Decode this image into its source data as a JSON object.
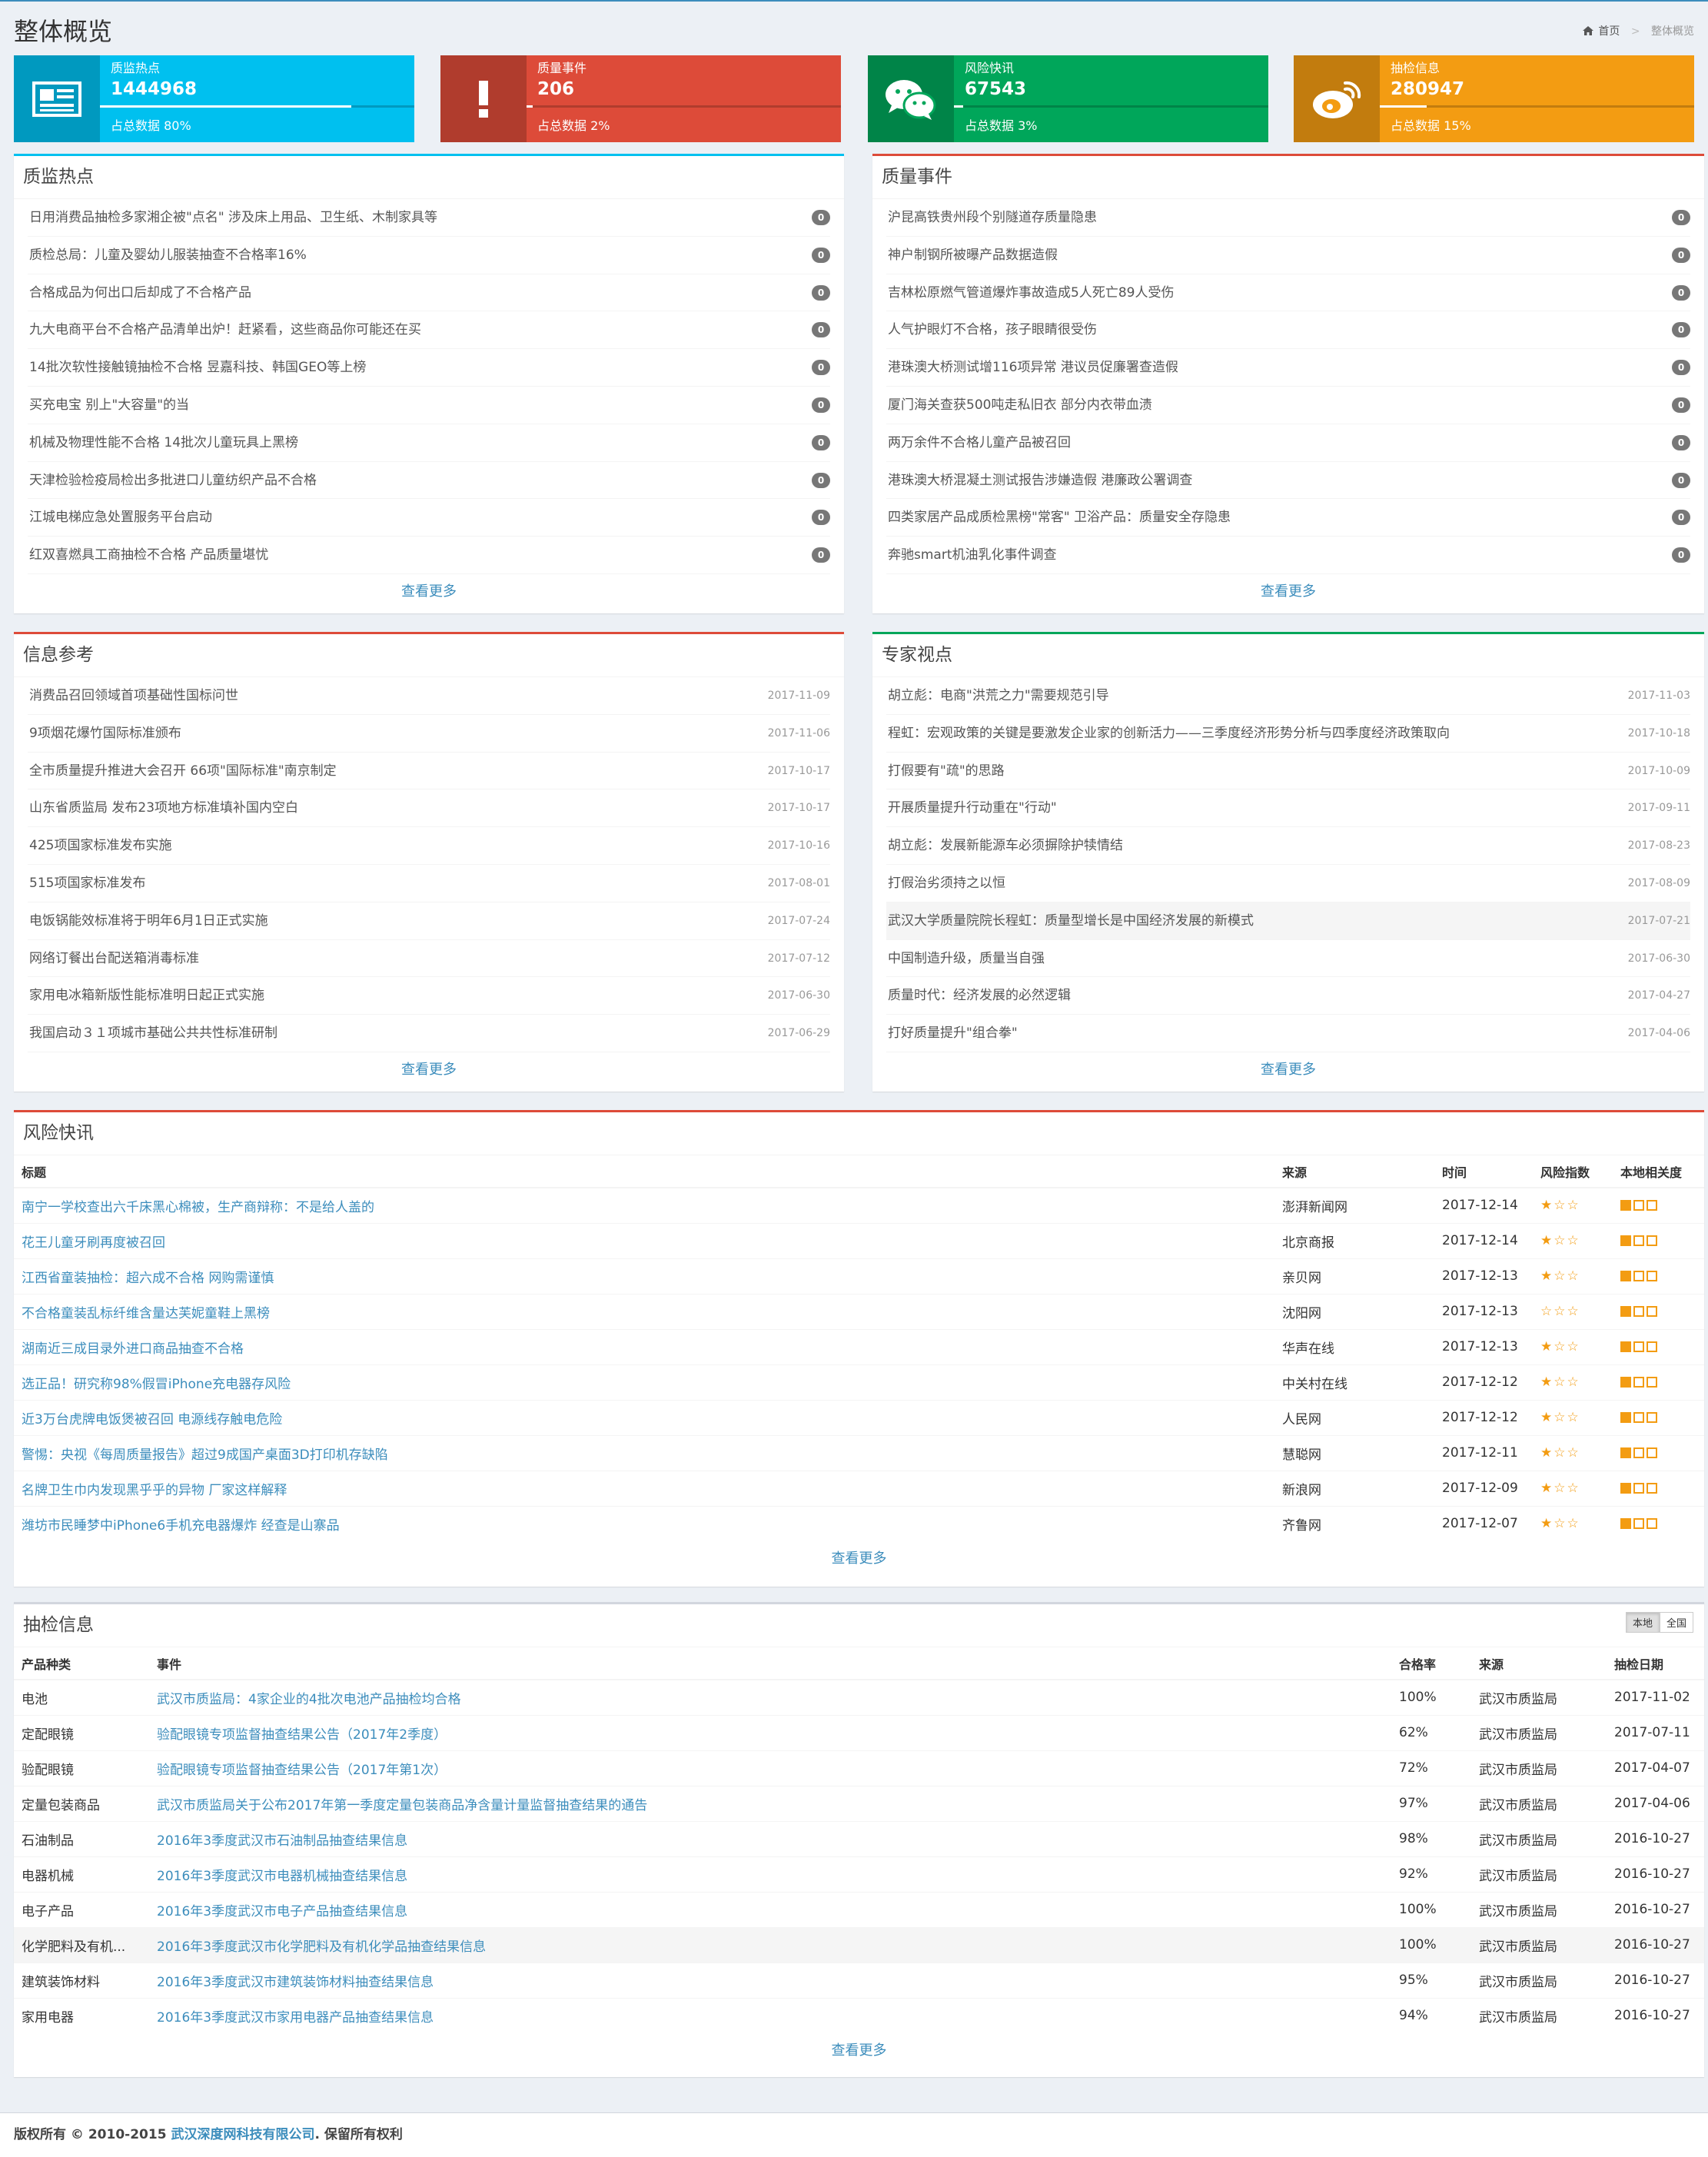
{
  "page": {
    "title": "整体概览",
    "breadcrumb_home": "首页",
    "breadcrumb_current": "整体概览"
  },
  "info_boxes": [
    {
      "label": "质监热点",
      "value": "1444968",
      "desc": "占总数据 80%",
      "percent": 80,
      "color": "#00c0ef",
      "icon": "newspaper-icon"
    },
    {
      "label": "质量事件",
      "value": "206",
      "desc": "占总数据 2%",
      "percent": 2,
      "color": "#dd4b39",
      "icon": "exclamation-icon"
    },
    {
      "label": "风险快讯",
      "value": "67543",
      "desc": "占总数据 3%",
      "percent": 3,
      "color": "#00a65a",
      "icon": "wechat-icon"
    },
    {
      "label": "抽检信息",
      "value": "280947",
      "desc": "占总数据 15%",
      "percent": 15,
      "color": "#f39c12",
      "icon": "weibo-icon"
    }
  ],
  "hotspots": {
    "title": "质监热点",
    "more": "查看更多",
    "items": [
      {
        "text": "日用消费品抽检多家湘企被\"点名\" 涉及床上用品、卫生纸、木制家具等",
        "count": "0"
      },
      {
        "text": "质检总局：儿童及婴幼儿服装抽查不合格率16%",
        "count": "0"
      },
      {
        "text": "合格成品为何出口后却成了不合格产品",
        "count": "0"
      },
      {
        "text": "九大电商平台不合格产品清单出炉！赶紧看，这些商品你可能还在买",
        "count": "0"
      },
      {
        "text": "14批次软性接触镜抽检不合格 昱嘉科技、韩国GEO等上榜",
        "count": "0"
      },
      {
        "text": "买充电宝 别上\"大容量\"的当",
        "count": "0"
      },
      {
        "text": "机械及物理性能不合格 14批次儿童玩具上黑榜",
        "count": "0"
      },
      {
        "text": "天津检验检疫局检出多批进口儿童纺织产品不合格",
        "count": "0"
      },
      {
        "text": "江城电梯应急处置服务平台启动",
        "count": "0"
      },
      {
        "text": "红双喜燃具工商抽检不合格 产品质量堪忧",
        "count": "0"
      }
    ]
  },
  "events": {
    "title": "质量事件",
    "more": "查看更多",
    "items": [
      {
        "text": "沪昆高铁贵州段个别隧道存质量隐患",
        "count": "0"
      },
      {
        "text": "神户制钢所被曝产品数据造假",
        "count": "0"
      },
      {
        "text": "吉林松原燃气管道爆炸事故造成5人死亡89人受伤",
        "count": "0"
      },
      {
        "text": "人气护眼灯不合格，孩子眼睛很受伤",
        "count": "0"
      },
      {
        "text": "港珠澳大桥测试增116项异常 港议员促廉署查造假",
        "count": "0"
      },
      {
        "text": "厦门海关查获500吨走私旧衣 部分内衣带血渍",
        "count": "0"
      },
      {
        "text": "两万余件不合格儿童产品被召回",
        "count": "0"
      },
      {
        "text": "港珠澳大桥混凝土测试报告涉嫌造假 港廉政公署调查",
        "count": "0"
      },
      {
        "text": "四类家居产品成质检黑榜\"常客\" 卫浴产品：质量安全存隐患",
        "count": "0"
      },
      {
        "text": "奔驰smart机油乳化事件调查",
        "count": "0"
      }
    ]
  },
  "references": {
    "title": "信息参考",
    "more": "查看更多",
    "items": [
      {
        "text": "消费品召回领域首项基础性国标问世",
        "date": "2017-11-09"
      },
      {
        "text": "9项烟花爆竹国际标准颁布",
        "date": "2017-11-06"
      },
      {
        "text": "全市质量提升推进大会召开 66项\"国际标准\"南京制定",
        "date": "2017-10-17"
      },
      {
        "text": "山东省质监局 发布23项地方标准填补国内空白",
        "date": "2017-10-17"
      },
      {
        "text": "425项国家标准发布实施",
        "date": "2017-10-16"
      },
      {
        "text": "515项国家标准发布",
        "date": "2017-08-01"
      },
      {
        "text": "电饭锅能效标准将于明年6月1日正式实施",
        "date": "2017-07-24"
      },
      {
        "text": "网络订餐出台配送箱消毒标准",
        "date": "2017-07-12"
      },
      {
        "text": "家用电冰箱新版性能标准明日起正式实施",
        "date": "2017-06-30"
      },
      {
        "text": "我国启动３１项城市基础公共共性标准研制",
        "date": "2017-06-29"
      }
    ]
  },
  "experts": {
    "title": "专家视点",
    "more": "查看更多",
    "items": [
      {
        "text": "胡立彪：电商\"洪荒之力\"需要规范引导",
        "date": "2017-11-03"
      },
      {
        "text": "程虹：宏观政策的关键是要激发企业家的创新活力——三季度经济形势分析与四季度经济政策取向",
        "date": "2017-10-18"
      },
      {
        "text": "打假要有\"疏\"的思路",
        "date": "2017-10-09"
      },
      {
        "text": "开展质量提升行动重在\"行动\"",
        "date": "2017-09-11"
      },
      {
        "text": "胡立彪：发展新能源车必须摒除护犊情结",
        "date": "2017-08-23"
      },
      {
        "text": "打假治劣须持之以恒",
        "date": "2017-08-09"
      },
      {
        "text": "武汉大学质量院院长程虹：质量型增长是中国经济发展的新模式",
        "date": "2017-07-21"
      },
      {
        "text": "中国制造升级，质量当自强",
        "date": "2017-06-30"
      },
      {
        "text": "质量时代：经济发展的必然逻辑",
        "date": "2017-04-27"
      },
      {
        "text": "打好质量提升\"组合拳\"",
        "date": "2017-04-06"
      }
    ]
  },
  "risk_news": {
    "title": "风险快讯",
    "more": "查看更多",
    "headers": [
      "标题",
      "来源",
      "时间",
      "风险指数",
      "本地相关度"
    ],
    "rows": [
      {
        "title": "南宁一学校查出六千床黑心棉被，生产商辩称：不是给人盖的",
        "source": "澎湃新闻网",
        "time": "2017-12-14",
        "risk": 1,
        "relevance": 1
      },
      {
        "title": "花王儿童牙刷再度被召回",
        "source": "北京商报",
        "time": "2017-12-14",
        "risk": 1,
        "relevance": 1
      },
      {
        "title": "江西省童装抽检：超六成不合格 网购需谨慎",
        "source": "亲贝网",
        "time": "2017-12-13",
        "risk": 1,
        "relevance": 1
      },
      {
        "title": "不合格童装乱标纤维含量达芙妮童鞋上黑榜",
        "source": "沈阳网",
        "time": "2017-12-13",
        "risk": 0,
        "relevance": 1
      },
      {
        "title": "湖南近三成目录外进口商品抽查不合格",
        "source": "华声在线",
        "time": "2017-12-13",
        "risk": 1,
        "relevance": 1
      },
      {
        "title": "选正品！研究称98%假冒iPhone充电器存风险",
        "source": "中关村在线",
        "time": "2017-12-12",
        "risk": 1,
        "relevance": 1
      },
      {
        "title": "近3万台虎牌电饭煲被召回 电源线存触电危险",
        "source": "人民网",
        "time": "2017-12-12",
        "risk": 1,
        "relevance": 1
      },
      {
        "title": "警惕：央视《每周质量报告》超过9成国产桌面3D打印机存缺陷",
        "source": "慧聪网",
        "time": "2017-12-11",
        "risk": 1,
        "relevance": 1
      },
      {
        "title": "名牌卫生巾内发现黑乎乎的异物 厂家这样解释",
        "source": "新浪网",
        "time": "2017-12-09",
        "risk": 1,
        "relevance": 1
      },
      {
        "title": "潍坊市民睡梦中iPhone6手机充电器爆炸 经查是山寨品",
        "source": "齐鲁网",
        "time": "2017-12-07",
        "risk": 1,
        "relevance": 1
      }
    ]
  },
  "inspections": {
    "title": "抽检信息",
    "more": "查看更多",
    "toggle_local": "本地",
    "toggle_all": "全国",
    "headers": [
      "产品种类",
      "事件",
      "合格率",
      "来源",
      "抽检日期"
    ],
    "rows": [
      {
        "category": "电池",
        "event": "武汉市质监局：4家企业的4批次电池产品抽检均合格",
        "rate": "100%",
        "source": "武汉市质监局",
        "date": "2017-11-02"
      },
      {
        "category": "定配眼镜",
        "event": "验配眼镜专项监督抽查结果公告（2017年2季度）",
        "rate": "62%",
        "source": "武汉市质监局",
        "date": "2017-07-11"
      },
      {
        "category": "验配眼镜",
        "event": "验配眼镜专项监督抽查结果公告（2017年第1次）",
        "rate": "72%",
        "source": "武汉市质监局",
        "date": "2017-04-07"
      },
      {
        "category": "定量包装商品",
        "event": "武汉市质监局关于公布2017年第一季度定量包装商品净含量计量监督抽查结果的通告",
        "rate": "97%",
        "source": "武汉市质监局",
        "date": "2017-04-06"
      },
      {
        "category": "石油制品",
        "event": "2016年3季度武汉市石油制品抽查结果信息",
        "rate": "98%",
        "source": "武汉市质监局",
        "date": "2016-10-27"
      },
      {
        "category": "电器机械",
        "event": "2016年3季度武汉市电器机械抽查结果信息",
        "rate": "92%",
        "source": "武汉市质监局",
        "date": "2016-10-27"
      },
      {
        "category": "电子产品",
        "event": "2016年3季度武汉市电子产品抽查结果信息",
        "rate": "100%",
        "source": "武汉市质监局",
        "date": "2016-10-27"
      },
      {
        "category": "化学肥料及有机...",
        "event": "2016年3季度武汉市化学肥料及有机化学品抽查结果信息",
        "rate": "100%",
        "source": "武汉市质监局",
        "date": "2016-10-27"
      },
      {
        "category": "建筑装饰材料",
        "event": "2016年3季度武汉市建筑装饰材料抽查结果信息",
        "rate": "95%",
        "source": "武汉市质监局",
        "date": "2016-10-27"
      },
      {
        "category": "家用电器",
        "event": "2016年3季度武汉市家用电器产品抽查结果信息",
        "rate": "94%",
        "source": "武汉市质监局",
        "date": "2016-10-27"
      }
    ]
  },
  "footer": {
    "prefix": "版权所有 © 2010-2015 ",
    "company": "武汉深度网科技有限公司",
    "suffix": ". 保留所有权利"
  }
}
